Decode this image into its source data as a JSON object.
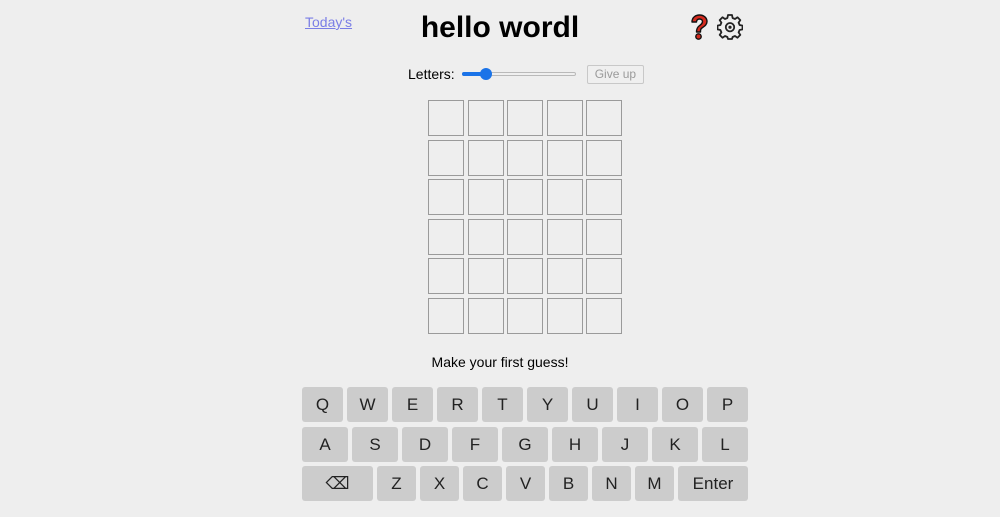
{
  "header": {
    "link_label": "Today's",
    "title": "hello wordl",
    "help_icon": "question-mark-icon",
    "settings_icon": "gear-icon"
  },
  "controls": {
    "letters_label": "Letters:",
    "letters_slider_level": 0.18,
    "give_up_label": "Give up"
  },
  "board": {
    "rows": 6,
    "cols": 5,
    "tiles": [
      [
        "",
        "",
        "",
        "",
        ""
      ],
      [
        "",
        "",
        "",
        "",
        ""
      ],
      [
        "",
        "",
        "",
        "",
        ""
      ],
      [
        "",
        "",
        "",
        "",
        ""
      ],
      [
        "",
        "",
        "",
        "",
        ""
      ],
      [
        "",
        "",
        "",
        "",
        ""
      ]
    ]
  },
  "message": "Make your first guess!",
  "keyboard": {
    "row1": [
      "Q",
      "W",
      "E",
      "R",
      "T",
      "Y",
      "U",
      "I",
      "O",
      "P"
    ],
    "row2": [
      "A",
      "S",
      "D",
      "F",
      "G",
      "H",
      "J",
      "K",
      "L"
    ],
    "row3": [
      "⌫",
      "Z",
      "X",
      "C",
      "V",
      "B",
      "N",
      "M",
      "Enter"
    ]
  },
  "colors": {
    "background": "#eeeeee",
    "key": "#cccccc",
    "accent": "#1a73e8",
    "link": "#7a7ee6"
  }
}
